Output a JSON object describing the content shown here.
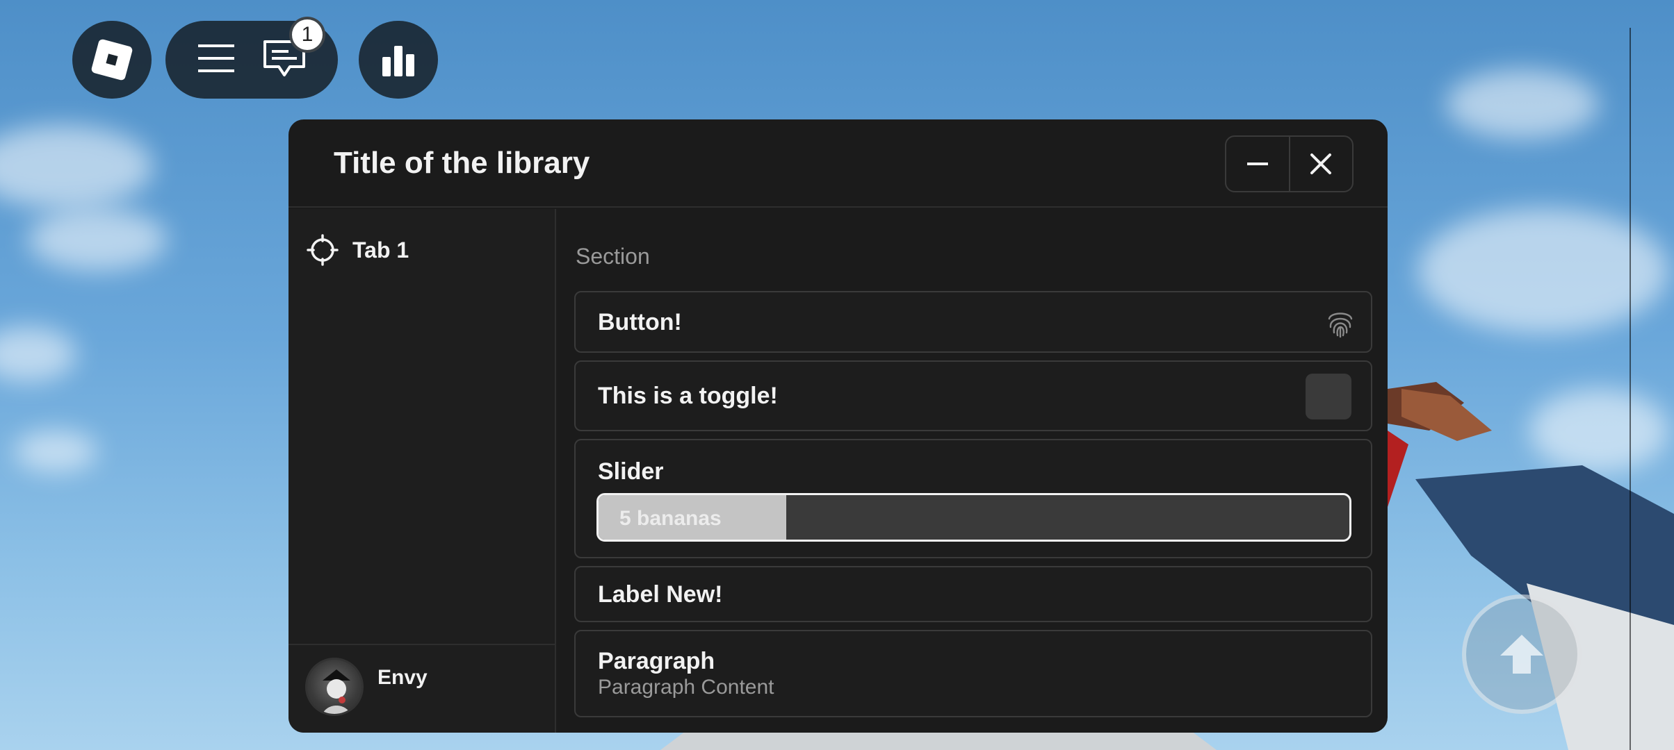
{
  "topbar": {
    "roblox_icon": "roblox-logo-icon",
    "menu_icon": "hamburger-menu-icon",
    "chat_icon": "chat-icon",
    "chat_badge": "1",
    "stats_icon": "leaderboard-icon"
  },
  "window": {
    "title": "Title of the library",
    "minimize_icon": "minus-icon",
    "close_icon": "close-icon"
  },
  "sidebar": {
    "tabs": [
      {
        "label": "Tab 1",
        "icon": "crosshair-icon"
      }
    ],
    "profile": {
      "username": "Envy"
    }
  },
  "content": {
    "section_title": "Section",
    "button": {
      "label": "Button!",
      "icon": "fingerprint-icon"
    },
    "toggle": {
      "label": "This is a toggle!",
      "checked": false
    },
    "slider": {
      "label": "Slider",
      "value_text": "5 bananas",
      "fill_fraction": 0.25
    },
    "label": {
      "text": "Label New!"
    },
    "paragraph": {
      "title": "Paragraph",
      "content": "Paragraph Content"
    }
  },
  "game": {
    "jump_icon": "jump-arrow-icon"
  },
  "colors": {
    "window_bg": "#1b1b1b",
    "card_border": "#3a3a3a",
    "text_primary": "#f2f2f2",
    "text_secondary": "#9a9a9a",
    "slider_fill": "#c4c4c4"
  }
}
